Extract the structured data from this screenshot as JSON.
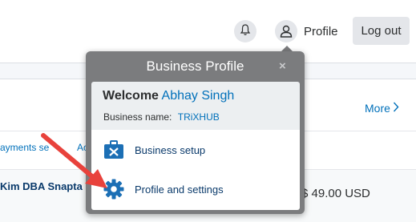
{
  "header": {
    "notifications_icon": "bell-icon",
    "profile_label": "Profile",
    "profile_icon": "user-icon",
    "logout_label": "Log out"
  },
  "card": {
    "more_label": "More",
    "tabs": [
      "ayments se",
      "Ac"
    ],
    "row": {
      "name": "Kim DBA Snapta",
      "amount": "-$ 49.00 USD"
    }
  },
  "popup": {
    "title": "Business Profile",
    "close_label": "×",
    "welcome_label": "Welcome",
    "user_name": "Abhay Singh",
    "business_name_label": "Business name:",
    "business_name_value": "TRiXHUB",
    "menu": [
      {
        "label": "Business setup",
        "icon": "toolbox-icon"
      },
      {
        "label": "Profile and settings",
        "icon": "gear-icon"
      }
    ]
  },
  "colors": {
    "accent": "#0070ba",
    "dark_link": "#0a3a6b",
    "popup_bg": "#7b7c7e",
    "annotation_arrow": "#e8423c"
  }
}
